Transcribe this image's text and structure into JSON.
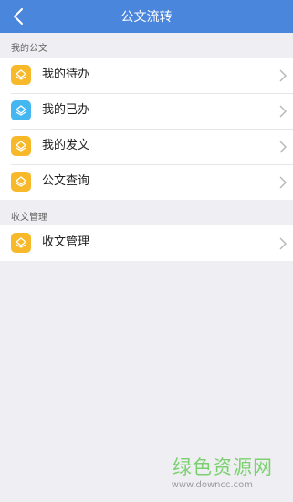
{
  "header": {
    "title": "公文流转"
  },
  "sections": [
    {
      "label": "我的公文",
      "items": [
        {
          "label": "我的待办",
          "icon": "document-stack-icon",
          "color": "#f7b92a"
        },
        {
          "label": "我的已办",
          "icon": "document-stack-icon",
          "color": "#45b7f0"
        },
        {
          "label": "我的发文",
          "icon": "document-stack-icon",
          "color": "#f7b92a"
        },
        {
          "label": "公文查询",
          "icon": "document-stack-icon",
          "color": "#f7b92a"
        }
      ]
    },
    {
      "label": "收文管理",
      "items": [
        {
          "label": "收文管理",
          "icon": "document-stack-icon",
          "color": "#f7b92a"
        }
      ]
    }
  ],
  "watermark": {
    "title": "绿色资源网",
    "url": "www.downcc.com"
  },
  "colors": {
    "header": "#4b86dd",
    "background": "#efeff3"
  }
}
